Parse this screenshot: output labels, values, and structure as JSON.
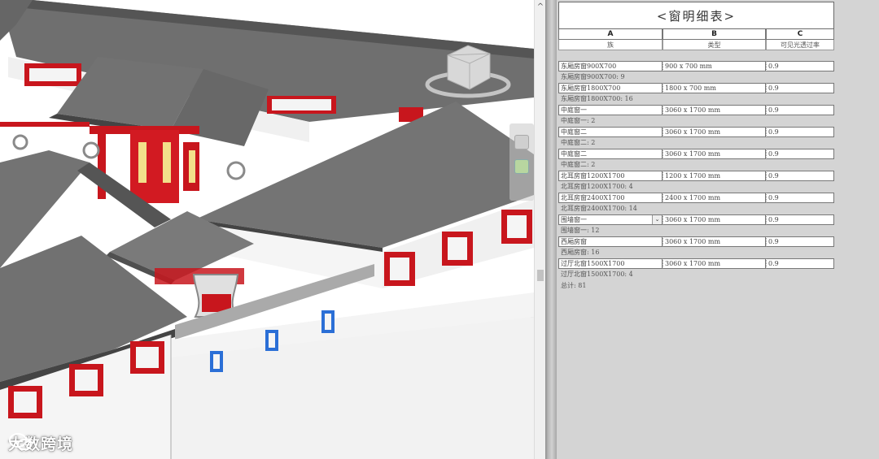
{
  "watermark": {
    "text": "大数跨境",
    "icon": "wechat-icon"
  },
  "scrollbar": {
    "up_arrow": "^"
  },
  "colors": {
    "roof": "#6e6e6e",
    "wall": "#f4f4f4",
    "frame": "#c8161d",
    "glass": "#2b6fd6",
    "pane_bg": "#d4d4d4"
  },
  "schedule": {
    "title": "<窗明细表>",
    "columns": [
      {
        "letter": "A",
        "name": "族"
      },
      {
        "letter": "B",
        "name": "类型"
      },
      {
        "letter": "C",
        "name": "可见光透过率"
      }
    ],
    "groups": [
      {
        "row": {
          "family": "东厢房窗900X700",
          "type": "900 x 700 mm",
          "value": "0.9"
        },
        "summary": "东厢房窗900X700: 9"
      },
      {
        "row": {
          "family": "东厢房窗1800X700",
          "type": "1800 x 700 mm",
          "value": "0.9"
        },
        "summary": "东厢房窗1800X700: 16"
      },
      {
        "row": {
          "family": "中庭窗一",
          "type": "3060 x 1700 mm",
          "value": "0.9"
        },
        "summary": "中庭窗一: 2"
      },
      {
        "row": {
          "family": "中庭窗二",
          "type": "3060 x 1700 mm",
          "value": "0.9"
        },
        "summary": "中庭窗二: 2"
      },
      {
        "row": {
          "family": "中庭窗二",
          "type": "3060 x 1700 mm",
          "value": "0.9"
        },
        "summary": "中庭窗二: 2"
      },
      {
        "row": {
          "family": "北耳房窗1200X1700",
          "type": "1200 x 1700 mm",
          "value": "0.9"
        },
        "summary": "北耳房窗1200X1700: 4"
      },
      {
        "row": {
          "family": "北耳房窗2400X1700",
          "type": "2400 x 1700 mm",
          "value": "0.9"
        },
        "summary": "北耳房窗2400X1700: 14"
      },
      {
        "row": {
          "family": "围墙窗一",
          "type": "3060 x 1700 mm",
          "value": "0.9"
        },
        "summary": "围墙窗一: 12"
      },
      {
        "row": {
          "family": "西厢房窗",
          "type": "3060 x 1700 mm",
          "value": "0.9"
        },
        "summary": "西厢房窗: 16"
      },
      {
        "row": {
          "family": "过厅北窗1500X1700",
          "type": "3060 x 1700 mm",
          "value": "0.9"
        },
        "summary": "过厅北窗1500X1700: 4"
      }
    ],
    "total": "总计: 81"
  }
}
